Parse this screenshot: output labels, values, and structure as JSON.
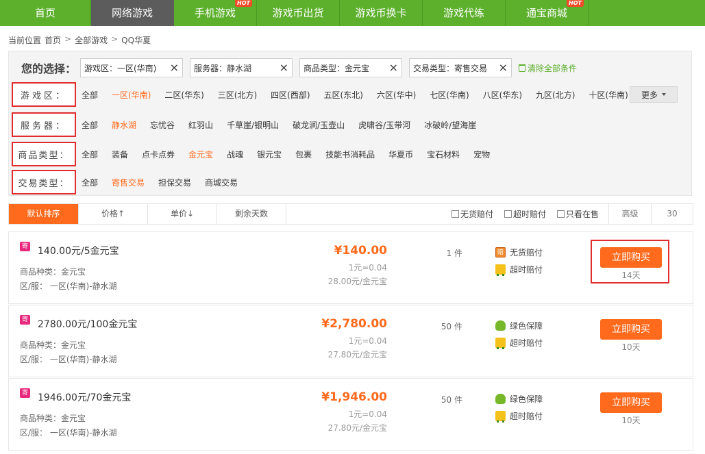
{
  "nav": {
    "items": [
      {
        "label": "首页",
        "hot": ""
      },
      {
        "label": "网络游戏",
        "hot": ""
      },
      {
        "label": "手机游戏",
        "hot": "HOT"
      },
      {
        "label": "游戏币出货",
        "hot": ""
      },
      {
        "label": "游戏币换卡",
        "hot": ""
      },
      {
        "label": "游戏代练",
        "hot": ""
      },
      {
        "label": "通宝商城",
        "hot": "HOT"
      }
    ],
    "active_index": 1,
    "colors": {
      "bar": "#5cb02c",
      "active": "#5c5c5c",
      "accent": "#ff6a1c"
    }
  },
  "breadcrumb": {
    "prefix": "当前位置",
    "items": [
      "首页",
      "全部游戏",
      "QQ华夏"
    ],
    "separator": ">"
  },
  "selection": {
    "title": "您的选择：",
    "chips": [
      "游戏区：一区(华南)",
      "服务器：静水湖",
      "商品类型：金元宝",
      "交易类型：寄售交易"
    ],
    "clear_all": "清除全部条件"
  },
  "filters": {
    "zone": {
      "label": "游戏区：",
      "options": [
        "全部",
        "一区(华南)",
        "二区(华东)",
        "三区(北方)",
        "四区(西部)",
        "五区(东北)",
        "六区(华中)",
        "七区(华南)",
        "八区(华东)",
        "九区(北方)",
        "十区(华南)"
      ],
      "selected": 1,
      "more": "更多"
    },
    "server": {
      "label": "服务器：",
      "options": [
        "全部",
        "静水湖",
        "忘忧谷",
        "红羽山",
        "千草崖/银明山",
        "破龙涧/玉壶山",
        "虎啸谷/玉带河",
        "冰破岭/望海崖"
      ],
      "selected": 1
    },
    "type": {
      "label": "商品类型：",
      "options": [
        "全部",
        "装备",
        "点卡点券",
        "金元宝",
        "战魂",
        "银元宝",
        "包裹",
        "技能书消耗品",
        "华夏币",
        "宝石材料",
        "宠物"
      ],
      "selected": 3
    },
    "trade": {
      "label": "交易类型：",
      "options": [
        "全部",
        "寄售交易",
        "担保交易",
        "商城交易"
      ],
      "selected": 1
    }
  },
  "sortbar": {
    "tabs": [
      "默认排序",
      "价格↑",
      "单价↓",
      "剩余天数"
    ],
    "checks": [
      "无货赔付",
      "超时赔付",
      "只看在售"
    ],
    "advanced": "高级",
    "per_page": "30"
  },
  "listings": [
    {
      "badge": "寄",
      "title": "140.00元/5金元宝",
      "kind": "商品种类：金元宝",
      "server": "区/服：  一区(华南)-静水湖",
      "price": "¥140.00",
      "unit1": "1元=0.04",
      "unit2": "28.00元/金元宝",
      "qty": "1 件",
      "guarantees": [
        {
          "icon": "pei",
          "glyph": "赔",
          "label": "无货赔付"
        },
        {
          "icon": "truck",
          "glyph": "",
          "label": "超时赔付"
        }
      ],
      "buy": "立即购买",
      "days": "14天"
    },
    {
      "badge": "寄",
      "title": "2780.00元/100金元宝",
      "kind": "商品种类：金元宝",
      "server": "区/服：  一区(华南)-静水湖",
      "price": "¥2,780.00",
      "unit1": "1元=0.04",
      "unit2": "27.80元/金元宝",
      "qty": "50 件",
      "guarantees": [
        {
          "icon": "shield",
          "glyph": "",
          "label": "绿色保障"
        },
        {
          "icon": "truck",
          "glyph": "",
          "label": "超时赔付"
        }
      ],
      "buy": "立即购买",
      "days": "10天"
    },
    {
      "badge": "寄",
      "title": "1946.00元/70金元宝",
      "kind": "商品种类：金元宝",
      "server": "区/服：  一区(华南)-静水湖",
      "price": "¥1,946.00",
      "unit1": "1元=0.04",
      "unit2": "27.80元/金元宝",
      "qty": "50 件",
      "guarantees": [
        {
          "icon": "shield",
          "glyph": "",
          "label": "绿色保障"
        },
        {
          "icon": "truck",
          "glyph": "",
          "label": "超时赔付"
        }
      ],
      "buy": "立即购买",
      "days": "10天"
    }
  ]
}
